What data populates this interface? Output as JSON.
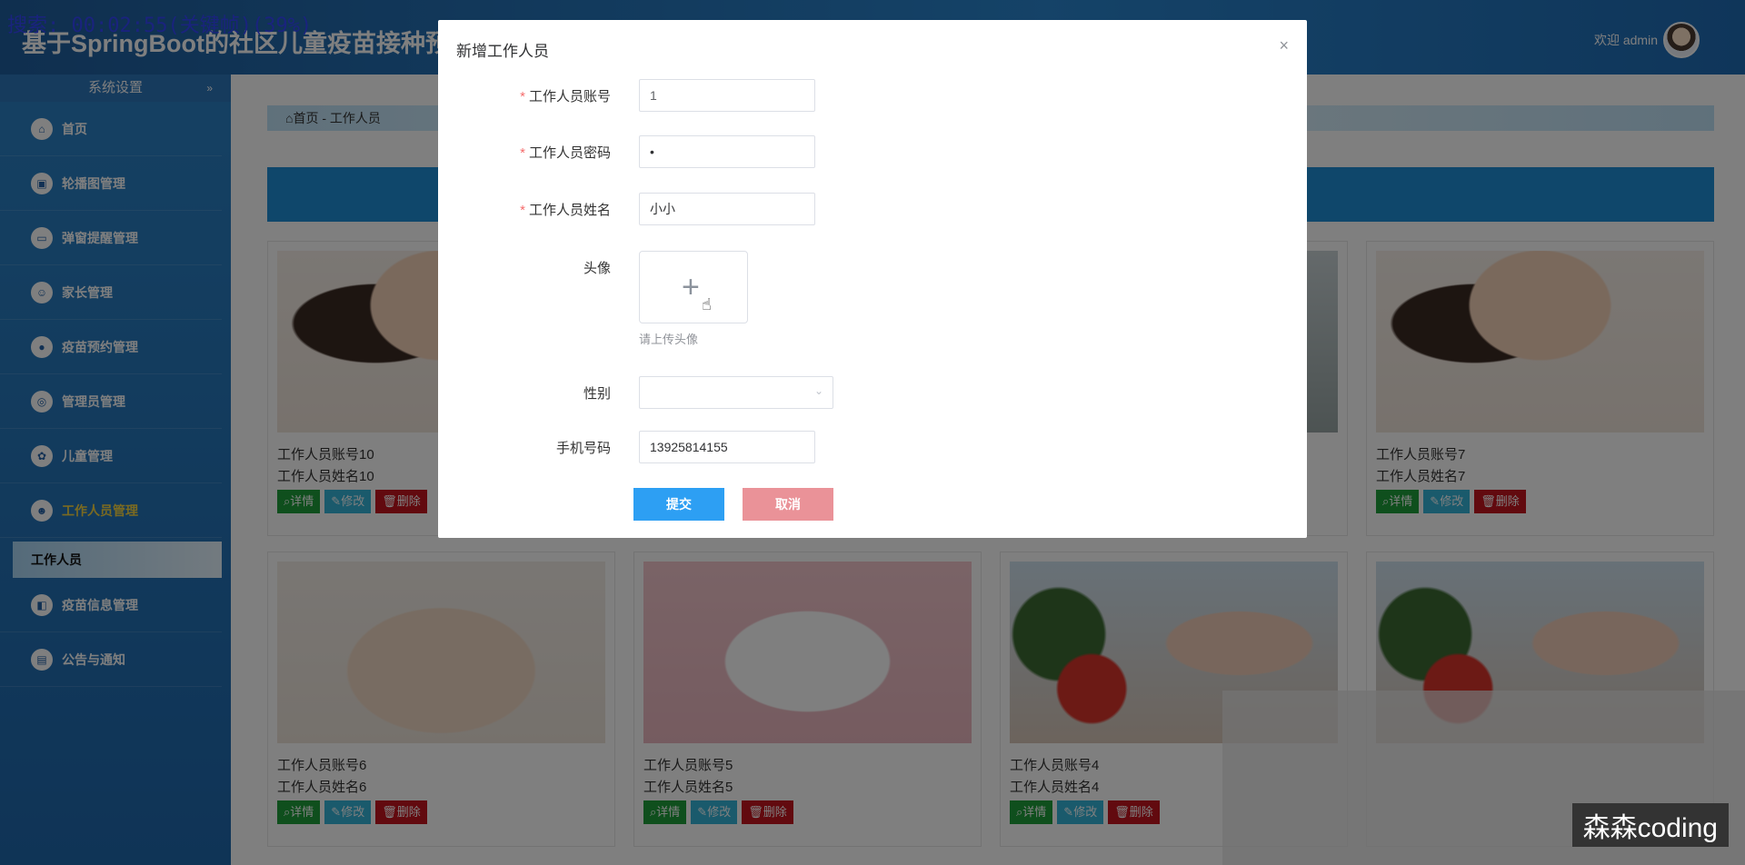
{
  "header": {
    "overlay_text": "搜索: 00:02:55(关键帧)(39%)",
    "title": "基于SpringBoot的社区儿童疫苗接种预约系",
    "welcome": "欢迎 admin"
  },
  "sidebar": {
    "group_label": "系统设置",
    "group_arrow": "»",
    "items": [
      {
        "label": "首页",
        "icon": "home-icon"
      },
      {
        "label": "轮播图管理",
        "icon": "image-icon"
      },
      {
        "label": "弹窗提醒管理",
        "icon": "popup-icon"
      },
      {
        "label": "家长管理",
        "icon": "user-icon"
      },
      {
        "label": "疫苗预约管理",
        "icon": "vaccine-icon"
      },
      {
        "label": "管理员管理",
        "icon": "admin-icon"
      },
      {
        "label": "儿童管理",
        "icon": "child-icon"
      },
      {
        "label": "工作人员管理",
        "icon": "staff-icon"
      },
      {
        "label": "疫苗信息管理",
        "icon": "info-icon"
      },
      {
        "label": "公告与通知",
        "icon": "notice-icon"
      }
    ],
    "submenu_label": "工作人员"
  },
  "breadcrumb": {
    "home": "首页",
    "sep": "-",
    "current": "工作人员"
  },
  "cards": [
    {
      "account": "工作人员账号10",
      "name": "工作人员姓名10"
    },
    {
      "account": "工作人员账号7",
      "name": "工作人员姓名7"
    },
    {
      "account": "工作人员账号6",
      "name": "工作人员姓名6"
    },
    {
      "account": "工作人员账号5",
      "name": "工作人员姓名5"
    },
    {
      "account": "工作人员账号4",
      "name": "工作人员姓名4"
    }
  ],
  "card_buttons": {
    "detail": "详情",
    "edit": "修改",
    "delete": "删除"
  },
  "dialog": {
    "title": "新增工作人员",
    "close": "×",
    "account_label": "工作人员账号",
    "account_value": "1",
    "password_label": "工作人员密码",
    "password_value": "•",
    "name_label": "工作人员姓名",
    "name_value": "小小",
    "avatar_label": "头像",
    "avatar_tip": "请上传头像",
    "gender_label": "性别",
    "gender_value": "",
    "phone_label": "手机号码",
    "phone_value": "13925814155",
    "submit": "提交",
    "cancel": "取消"
  },
  "watermark": "森森coding",
  "colors": {
    "accent": "#2d9ff3",
    "cancel": "#ea9298",
    "sidebar": "#2b82c6",
    "required": "#f56c6c"
  }
}
